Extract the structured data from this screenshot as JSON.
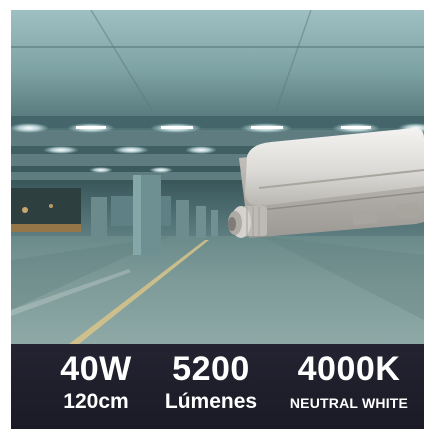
{
  "specs": {
    "power": {
      "value": "40W",
      "detail": "120cm"
    },
    "lumens": {
      "value": "5200",
      "detail": "Lúmenes"
    },
    "color_temperature": {
      "value": "4000K",
      "detail": "NEUTRAL WHITE"
    }
  }
}
